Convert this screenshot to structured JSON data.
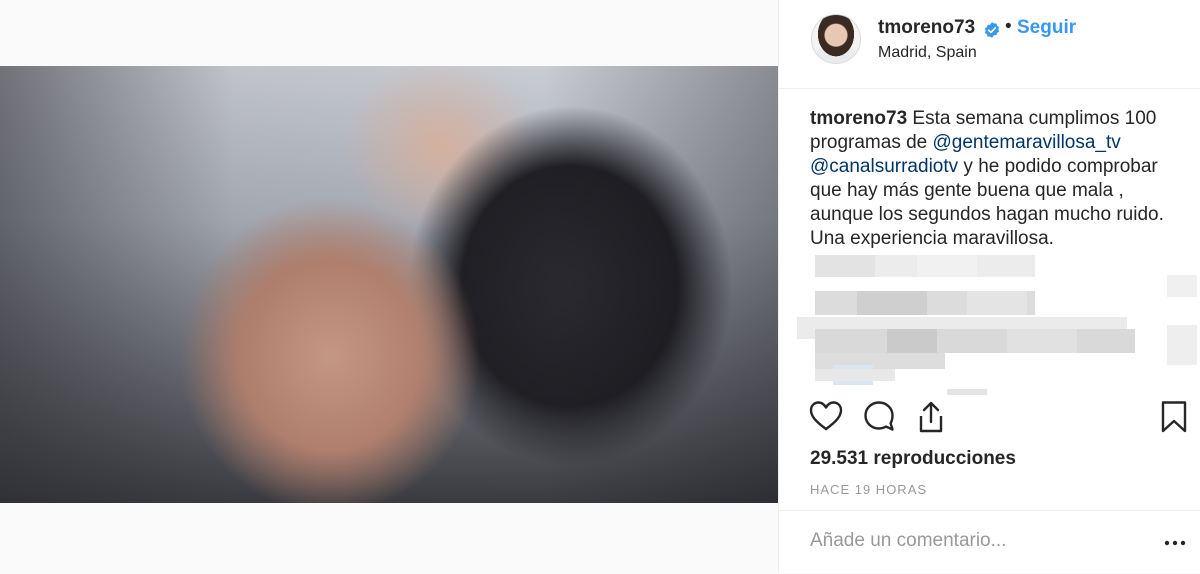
{
  "post": {
    "username": "tmoreno73",
    "follow_label": "Seguir",
    "dot": "•",
    "location": "Madrid, Spain"
  },
  "caption": {
    "username": "tmoreno73",
    "text_1": " Esta semana cumplimos 100 programas de ",
    "mention_1": "@gentemaravillosa_tv",
    "space": " ",
    "mention_2": "@canalsurradiotv",
    "text_2": " y he podido comprobar que hay más gente buena que mala , aunque los segundos hagan mucho ruido. Una experiencia maravillosa."
  },
  "stats": {
    "views": "29.531 reproducciones",
    "time": "HACE 19 HORAS"
  },
  "comment": {
    "placeholder": "Añade un comentario..."
  },
  "icons": {
    "like": "heart-icon",
    "comment": "comment-icon",
    "share": "share-icon",
    "save": "bookmark-icon",
    "more": "more-options-icon",
    "verified": "verified-badge-icon"
  },
  "colors": {
    "link": "#3897f0",
    "mention": "#003569",
    "muted": "#999999",
    "text": "#262626"
  }
}
